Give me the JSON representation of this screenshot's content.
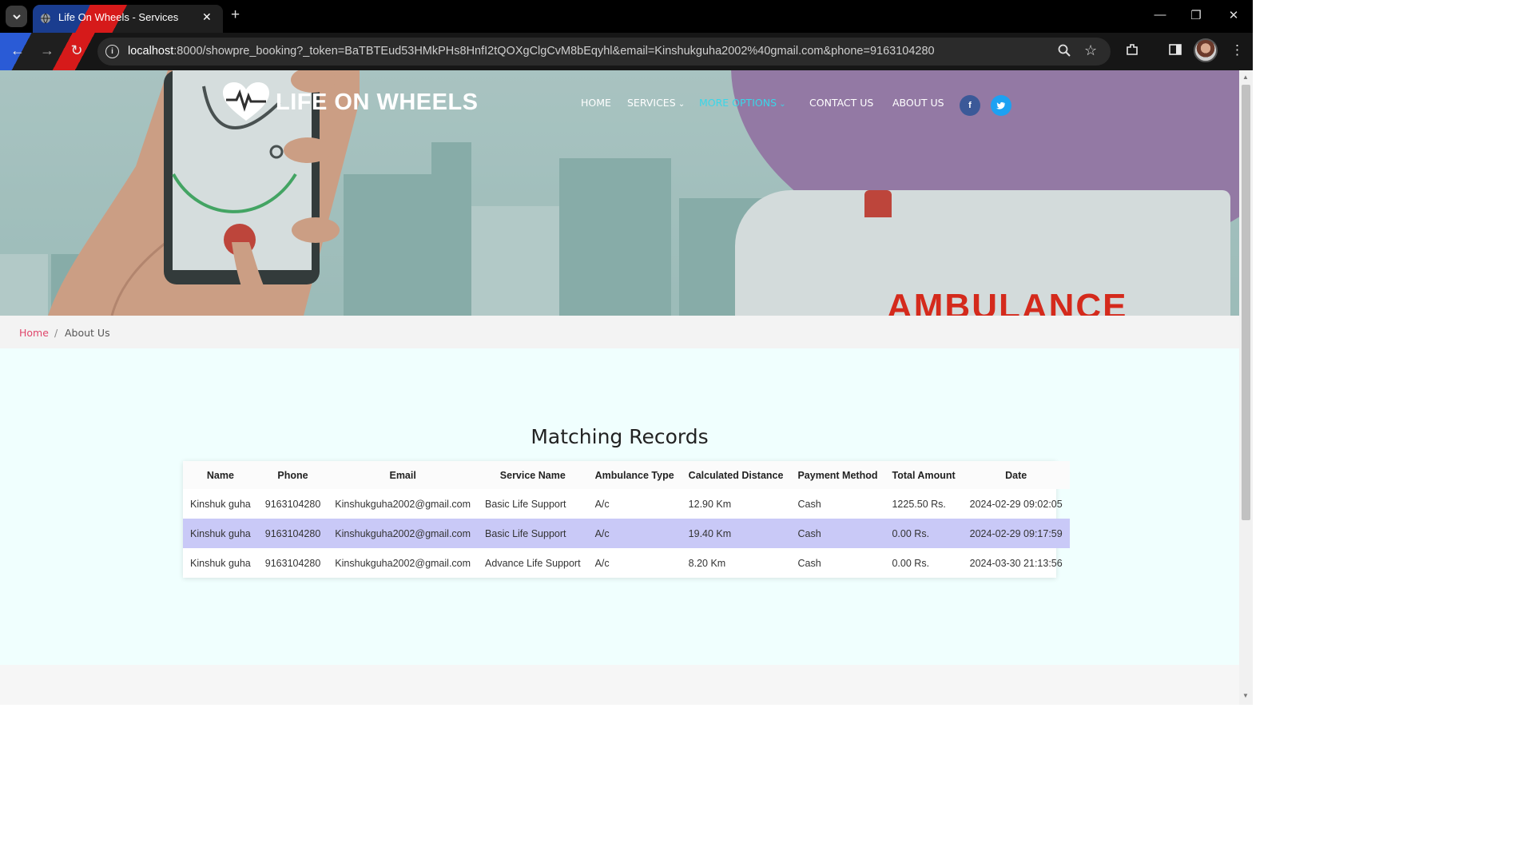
{
  "browser": {
    "tab_title": "Life On Wheels - Services",
    "url_host": "localhost",
    "url_rest": ":8000/showpre_booking?_token=BaTBTEud53HMkPHs8HnfI2tQOXgClgCvM8bEqyhl&email=Kinshukguha2002%40gmail.com&phone=9163104280"
  },
  "site": {
    "logo_text": "LIFE ON WHEELS",
    "nav": {
      "home": "HOME",
      "services": "SERVICES",
      "more_options": "MORE OPTIONS",
      "contact": "CONTACT US",
      "about": "ABOUT US"
    },
    "social": {
      "facebook": "f",
      "twitter": "t"
    },
    "hero_text": "AMBULANCE",
    "accent": "#3ad6e8"
  },
  "breadcrumb": {
    "home": "Home",
    "separator": "/",
    "current": "About Us"
  },
  "records": {
    "heading": "Matching Records",
    "columns": [
      "Name",
      "Phone",
      "Email",
      "Service Name",
      "Ambulance Type",
      "Calculated Distance",
      "Payment Method",
      "Total Amount",
      "Date"
    ],
    "rows": [
      [
        "Kinshuk guha",
        "9163104280",
        "Kinshukguha2002@gmail.com",
        "Basic Life Support",
        "A/c",
        "12.90 Km",
        "Cash",
        "1225.50 Rs.",
        "2024-02-29 09:02:05"
      ],
      [
        "Kinshuk guha",
        "9163104280",
        "Kinshukguha2002@gmail.com",
        "Basic Life Support",
        "A/c",
        "19.40 Km",
        "Cash",
        "0.00 Rs.",
        "2024-02-29 09:17:59"
      ],
      [
        "Kinshuk guha",
        "9163104280",
        "Kinshukguha2002@gmail.com",
        "Advance Life Support",
        "A/c",
        "8.20 Km",
        "Cash",
        "0.00 Rs.",
        "2024-03-30 21:13:56"
      ]
    ],
    "highlight_row_color": "#c9c9f7"
  }
}
